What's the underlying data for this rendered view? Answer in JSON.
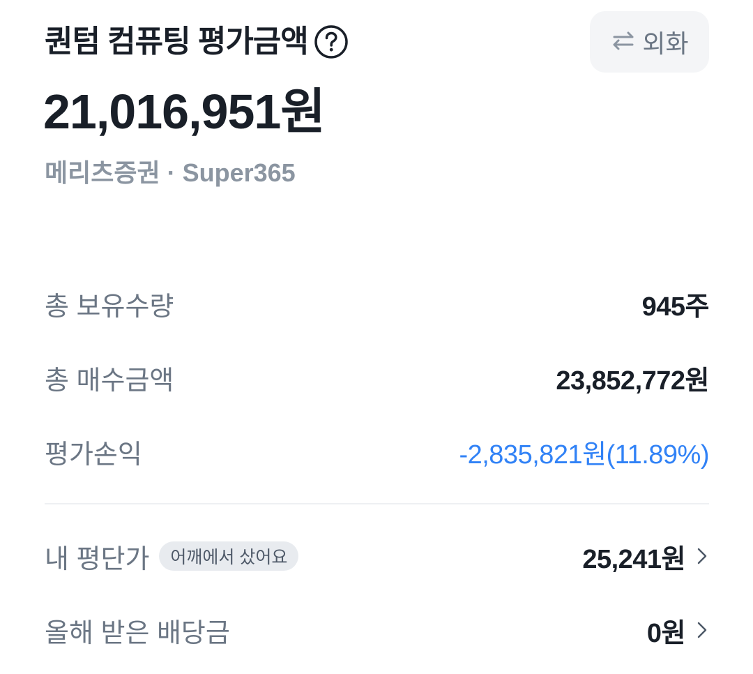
{
  "header": {
    "title": "퀀텀 컴퓨팅 평가금액",
    "help_icon": "question-circle-icon",
    "fx_button_label": "외화",
    "fx_icon": "swap-arrows-icon"
  },
  "summary": {
    "total_value": "21,016,951원",
    "broker": "메리츠증권 · Super365"
  },
  "stats": [
    {
      "label": "총 보유수량",
      "value": "945주"
    },
    {
      "label": "총 매수금액",
      "value": "23,852,772원"
    },
    {
      "label": "평가손익",
      "value": "-2,835,821원(11.89%)"
    }
  ],
  "details": [
    {
      "label": "내 평단가",
      "badge": "어깨에서 샀어요",
      "value": "25,241원"
    },
    {
      "label": "올해 받은 배당금",
      "value": "0원"
    }
  ],
  "colors": {
    "primary_text": "#191f28",
    "secondary_text": "#6b7684",
    "muted_text": "#8b95a1",
    "loss_blue": "#3182f6",
    "chip_bg": "#f4f5f7",
    "badge_bg": "#e8ebef"
  }
}
